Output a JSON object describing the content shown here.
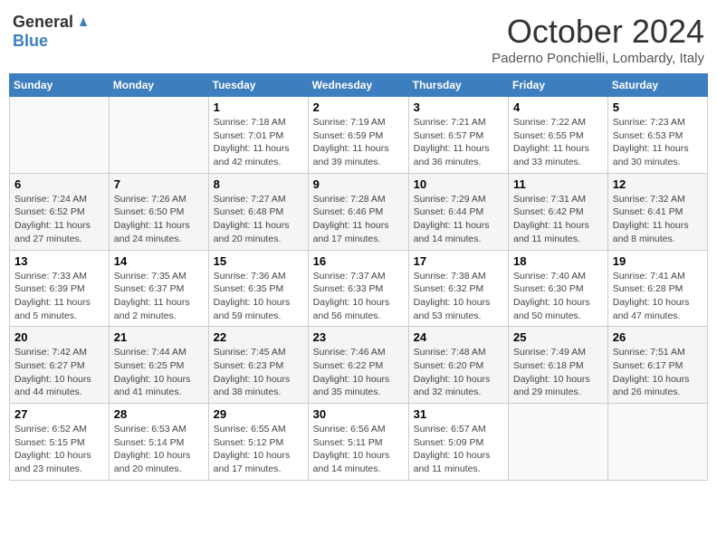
{
  "header": {
    "logo_general": "General",
    "logo_blue": "Blue",
    "month": "October 2024",
    "location": "Paderno Ponchielli, Lombardy, Italy"
  },
  "calendar": {
    "weekdays": [
      "Sunday",
      "Monday",
      "Tuesday",
      "Wednesday",
      "Thursday",
      "Friday",
      "Saturday"
    ],
    "weeks": [
      [
        {
          "day": "",
          "info": ""
        },
        {
          "day": "",
          "info": ""
        },
        {
          "day": "1",
          "info": "Sunrise: 7:18 AM\nSunset: 7:01 PM\nDaylight: 11 hours and 42 minutes."
        },
        {
          "day": "2",
          "info": "Sunrise: 7:19 AM\nSunset: 6:59 PM\nDaylight: 11 hours and 39 minutes."
        },
        {
          "day": "3",
          "info": "Sunrise: 7:21 AM\nSunset: 6:57 PM\nDaylight: 11 hours and 36 minutes."
        },
        {
          "day": "4",
          "info": "Sunrise: 7:22 AM\nSunset: 6:55 PM\nDaylight: 11 hours and 33 minutes."
        },
        {
          "day": "5",
          "info": "Sunrise: 7:23 AM\nSunset: 6:53 PM\nDaylight: 11 hours and 30 minutes."
        }
      ],
      [
        {
          "day": "6",
          "info": "Sunrise: 7:24 AM\nSunset: 6:52 PM\nDaylight: 11 hours and 27 minutes."
        },
        {
          "day": "7",
          "info": "Sunrise: 7:26 AM\nSunset: 6:50 PM\nDaylight: 11 hours and 24 minutes."
        },
        {
          "day": "8",
          "info": "Sunrise: 7:27 AM\nSunset: 6:48 PM\nDaylight: 11 hours and 20 minutes."
        },
        {
          "day": "9",
          "info": "Sunrise: 7:28 AM\nSunset: 6:46 PM\nDaylight: 11 hours and 17 minutes."
        },
        {
          "day": "10",
          "info": "Sunrise: 7:29 AM\nSunset: 6:44 PM\nDaylight: 11 hours and 14 minutes."
        },
        {
          "day": "11",
          "info": "Sunrise: 7:31 AM\nSunset: 6:42 PM\nDaylight: 11 hours and 11 minutes."
        },
        {
          "day": "12",
          "info": "Sunrise: 7:32 AM\nSunset: 6:41 PM\nDaylight: 11 hours and 8 minutes."
        }
      ],
      [
        {
          "day": "13",
          "info": "Sunrise: 7:33 AM\nSunset: 6:39 PM\nDaylight: 11 hours and 5 minutes."
        },
        {
          "day": "14",
          "info": "Sunrise: 7:35 AM\nSunset: 6:37 PM\nDaylight: 11 hours and 2 minutes."
        },
        {
          "day": "15",
          "info": "Sunrise: 7:36 AM\nSunset: 6:35 PM\nDaylight: 10 hours and 59 minutes."
        },
        {
          "day": "16",
          "info": "Sunrise: 7:37 AM\nSunset: 6:33 PM\nDaylight: 10 hours and 56 minutes."
        },
        {
          "day": "17",
          "info": "Sunrise: 7:38 AM\nSunset: 6:32 PM\nDaylight: 10 hours and 53 minutes."
        },
        {
          "day": "18",
          "info": "Sunrise: 7:40 AM\nSunset: 6:30 PM\nDaylight: 10 hours and 50 minutes."
        },
        {
          "day": "19",
          "info": "Sunrise: 7:41 AM\nSunset: 6:28 PM\nDaylight: 10 hours and 47 minutes."
        }
      ],
      [
        {
          "day": "20",
          "info": "Sunrise: 7:42 AM\nSunset: 6:27 PM\nDaylight: 10 hours and 44 minutes."
        },
        {
          "day": "21",
          "info": "Sunrise: 7:44 AM\nSunset: 6:25 PM\nDaylight: 10 hours and 41 minutes."
        },
        {
          "day": "22",
          "info": "Sunrise: 7:45 AM\nSunset: 6:23 PM\nDaylight: 10 hours and 38 minutes."
        },
        {
          "day": "23",
          "info": "Sunrise: 7:46 AM\nSunset: 6:22 PM\nDaylight: 10 hours and 35 minutes."
        },
        {
          "day": "24",
          "info": "Sunrise: 7:48 AM\nSunset: 6:20 PM\nDaylight: 10 hours and 32 minutes."
        },
        {
          "day": "25",
          "info": "Sunrise: 7:49 AM\nSunset: 6:18 PM\nDaylight: 10 hours and 29 minutes."
        },
        {
          "day": "26",
          "info": "Sunrise: 7:51 AM\nSunset: 6:17 PM\nDaylight: 10 hours and 26 minutes."
        }
      ],
      [
        {
          "day": "27",
          "info": "Sunrise: 6:52 AM\nSunset: 5:15 PM\nDaylight: 10 hours and 23 minutes."
        },
        {
          "day": "28",
          "info": "Sunrise: 6:53 AM\nSunset: 5:14 PM\nDaylight: 10 hours and 20 minutes."
        },
        {
          "day": "29",
          "info": "Sunrise: 6:55 AM\nSunset: 5:12 PM\nDaylight: 10 hours and 17 minutes."
        },
        {
          "day": "30",
          "info": "Sunrise: 6:56 AM\nSunset: 5:11 PM\nDaylight: 10 hours and 14 minutes."
        },
        {
          "day": "31",
          "info": "Sunrise: 6:57 AM\nSunset: 5:09 PM\nDaylight: 10 hours and 11 minutes."
        },
        {
          "day": "",
          "info": ""
        },
        {
          "day": "",
          "info": ""
        }
      ]
    ]
  }
}
